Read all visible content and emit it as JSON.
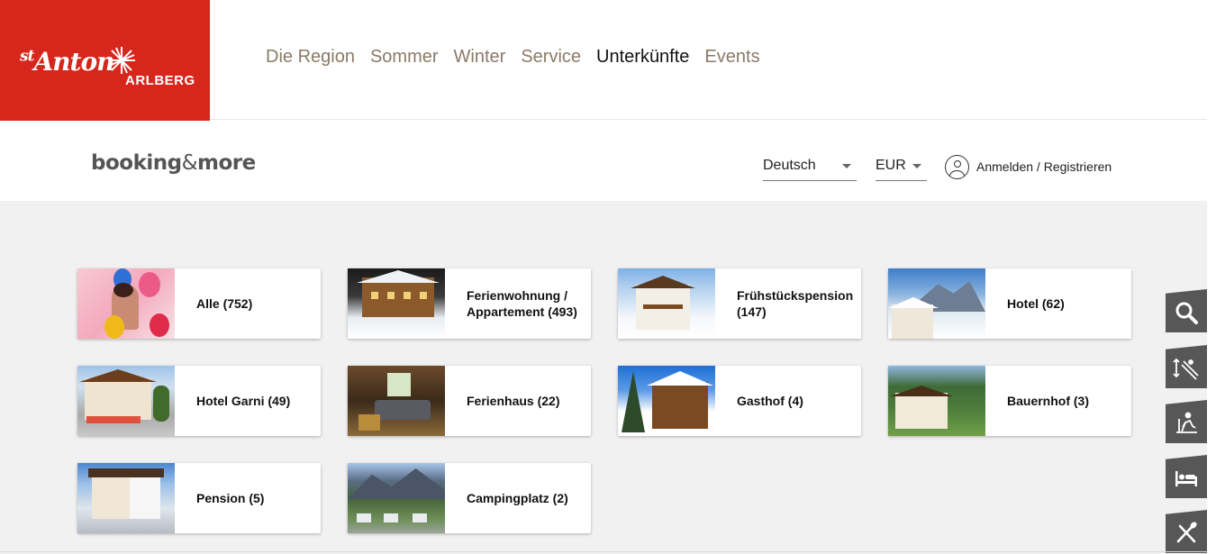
{
  "logo": {
    "st": "st",
    "anton": "Anton",
    "arlberg": "ARLBERG"
  },
  "nav": [
    "Die Region",
    "Sommer",
    "Winter",
    "Service",
    "Unterkünfte",
    "Events"
  ],
  "nav_active": "Unterkünfte",
  "booking": {
    "logo_main": "booking",
    "logo_amp": "&",
    "logo_more": "more",
    "language": "Deutsch",
    "currency": "EUR",
    "account_label": "Anmelden / Registrieren"
  },
  "categories": [
    {
      "label": "Alle (752)",
      "thumb": "balloons-photo"
    },
    {
      "label": "Ferienwohnung / Appartement (493)",
      "thumb": "chalet-winter-photo"
    },
    {
      "label": "Frühstückspension (147)",
      "thumb": "guesthouse-winter-photo"
    },
    {
      "label": "Hotel (62)",
      "thumb": "hotel-mountain-photo"
    },
    {
      "label": "Hotel Garni (49)",
      "thumb": "hotel-garni-photo"
    },
    {
      "label": "Ferienhaus (22)",
      "thumb": "livingroom-photo"
    },
    {
      "label": "Gasthof (4)",
      "thumb": "gasthof-winter-photo"
    },
    {
      "label": "Bauernhof (3)",
      "thumb": "farmhouse-photo"
    },
    {
      "label": "Pension (5)",
      "thumb": "pension-photo"
    },
    {
      "label": "Campingplatz (2)",
      "thumb": "campsite-photo"
    }
  ],
  "side_toolbar": [
    "search-icon",
    "ski-slope-icon",
    "skiing-icon",
    "bed-icon",
    "cutlery-icon"
  ],
  "colors": {
    "brand_red": "#d7261b",
    "nav_text": "#8a7a67",
    "sidebar_bg": "#575757",
    "content_bg": "#f1f1f1"
  }
}
